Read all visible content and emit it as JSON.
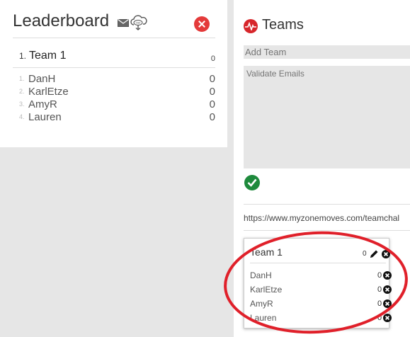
{
  "leaderboard": {
    "title": "Leaderboard",
    "email_icon": "envelope-icon",
    "csv_icon": "cloud-download-csv-icon",
    "csv_label": "csv",
    "close_icon": "close-circle-icon",
    "team": {
      "rank": "1.",
      "name": "Team 1",
      "score": "0"
    },
    "members": [
      {
        "rank": "1.",
        "name": "DanH",
        "score": "0"
      },
      {
        "rank": "2.",
        "name": "KarlEtze",
        "score": "0"
      },
      {
        "rank": "3.",
        "name": "AmyR",
        "score": "0"
      },
      {
        "rank": "4.",
        "name": "Lauren",
        "score": "0"
      }
    ]
  },
  "teams": {
    "title": "Teams",
    "logo_icon": "myzone-heartbeat-icon",
    "add_team_placeholder": "Add Team",
    "validate_emails_placeholder": "Validate Emails",
    "confirm_icon": "check-circle-icon",
    "url": "https://www.myzonemoves.com/teamchal",
    "card": {
      "name": "Team 1",
      "score": "0",
      "edit_icon": "pencil-icon",
      "remove_icon": "x-circle-icon",
      "members": [
        {
          "name": "DanH",
          "score": "0"
        },
        {
          "name": "KarlEtze",
          "score": "0"
        },
        {
          "name": "AmyR",
          "score": "0"
        },
        {
          "name": "Lauren",
          "score": "0"
        }
      ]
    }
  },
  "colors": {
    "background": "#e6e6e6",
    "panel": "#ffffff",
    "brand_red": "#d7262b",
    "close_red": "#e43a3a",
    "confirm_green": "#1e8a3c",
    "annotation_red": "#e0202a"
  }
}
